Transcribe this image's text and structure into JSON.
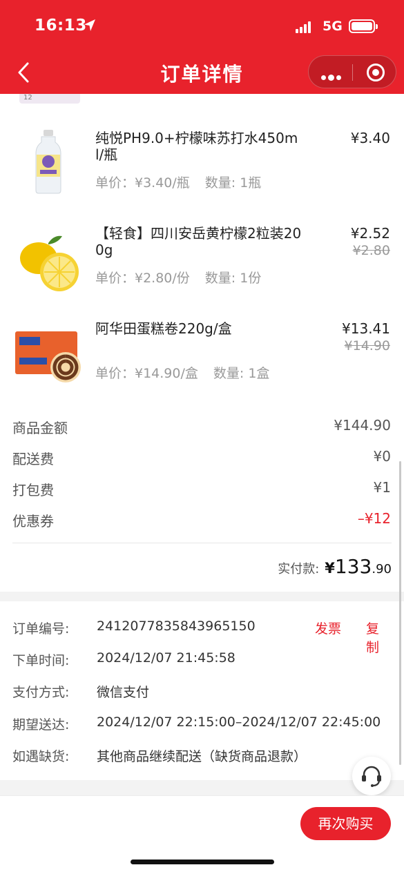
{
  "status_bar": {
    "time": "16:13",
    "network": "5G"
  },
  "header": {
    "title": "订单详情"
  },
  "products": [
    {
      "name": "纯悦PH9.0+柠檬味苏打水450ml/瓶",
      "price": "¥3.40",
      "original_price": "",
      "unit_price": "单价：¥3.40/瓶",
      "quantity": "数量: 1瓶"
    },
    {
      "name": "【轻食】四川安岳黄柠檬2粒装200g",
      "price": "¥2.52",
      "original_price": "¥2.80",
      "unit_price": "单价：¥2.80/份",
      "quantity": "数量: 1份"
    },
    {
      "name": "阿华田蛋糕卷220g/盒",
      "price": "¥13.41",
      "original_price": "¥14.90",
      "unit_price": "单价：¥14.90/盒",
      "quantity": "数量: 1盒"
    }
  ],
  "fees": [
    {
      "label": "商品金额",
      "value": "¥144.90"
    },
    {
      "label": "配送费",
      "value": "¥0"
    },
    {
      "label": "打包费",
      "value": "¥1"
    },
    {
      "label": "优惠券",
      "value": "–¥12"
    }
  ],
  "paid": {
    "label": "实付款:",
    "symbol": "¥",
    "integer": "133",
    "decimal": ".90"
  },
  "order_info": {
    "order_no_label": "订单编号:",
    "order_no": "2412077835843965150",
    "invoice_label": "发票",
    "copy_label": "复制",
    "time_label": "下单时间:",
    "time": "2024/12/07 21:45:58",
    "pay_label": "支付方式:",
    "pay": "微信支付",
    "expected_label": "期望送达:",
    "expected": "2024/12/07 22:15:00–2024/12/07 22:45:00",
    "out_of_stock_label": "如遇缺货:",
    "out_of_stock": "其他商品继续配送（缺货商品退款）"
  },
  "actions": {
    "rebuy": "再次购买"
  },
  "colors": {
    "brand_red": "#e8222c"
  },
  "icons": [
    "location-arrow-icon",
    "signal-icon",
    "battery-icon",
    "back-arrow-icon",
    "more-dots-icon",
    "target-icon",
    "customer-service-icon"
  ]
}
